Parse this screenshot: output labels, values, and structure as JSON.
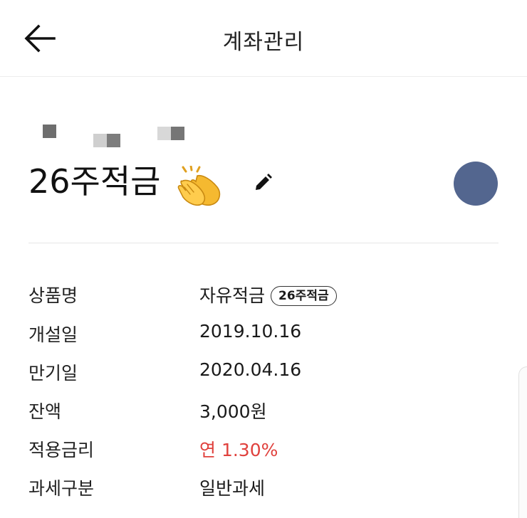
{
  "header": {
    "title": "계좌관리",
    "back_icon": "arrow-left-icon"
  },
  "account": {
    "name": "26주적금",
    "emoji": "👏",
    "edit_icon": "pencil-icon",
    "avatar_color": "#53668f"
  },
  "details": [
    {
      "label": "상품명",
      "value": "자유적금",
      "badge": "26주적금"
    },
    {
      "label": "개설일",
      "value": "2019.10.16"
    },
    {
      "label": "만기일",
      "value": "2020.04.16"
    },
    {
      "label": "잔액",
      "value": "3,000원"
    },
    {
      "label": "적용금리",
      "value": "연 1.30%",
      "color": "#e0413d"
    },
    {
      "label": "과세구분",
      "value": "일반과세"
    }
  ]
}
